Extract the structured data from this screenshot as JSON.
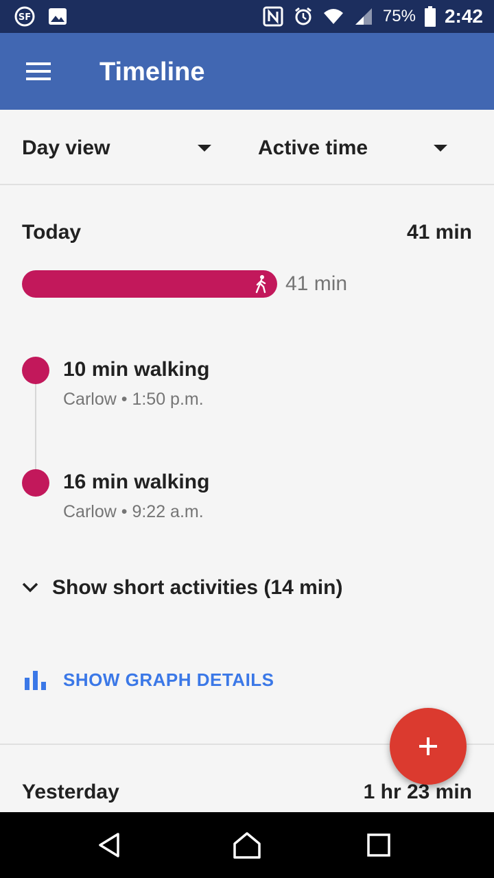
{
  "status_bar": {
    "battery_percent": "75%",
    "time": "2:42",
    "icons": [
      "sf-icon",
      "image-icon",
      "nfc-icon",
      "alarm-icon",
      "wifi-icon",
      "signal-icon",
      "battery-icon"
    ]
  },
  "app_bar": {
    "title": "Timeline",
    "menu_icon": "hamburger-menu-icon",
    "color": "#4167b2"
  },
  "filters": {
    "view": "Day view",
    "metric": "Active time"
  },
  "today": {
    "label": "Today",
    "total": "41 min",
    "bar_label": "41 min",
    "bar_color": "#c2185b"
  },
  "activities": [
    {
      "title": "10 min walking",
      "subtitle": "Carlow • 1:50 p.m."
    },
    {
      "title": "16 min walking",
      "subtitle": "Carlow • 9:22 a.m."
    }
  ],
  "short_activities": "Show short activities (14 min)",
  "graph_details": "SHOW GRAPH DETAILS",
  "yesterday": {
    "label": "Yesterday",
    "total": "1 hr 23 min"
  },
  "fab": {
    "icon": "plus-icon",
    "color": "#db3a2f"
  },
  "nav": {
    "icons": [
      "back-icon",
      "home-icon",
      "recents-icon"
    ]
  }
}
